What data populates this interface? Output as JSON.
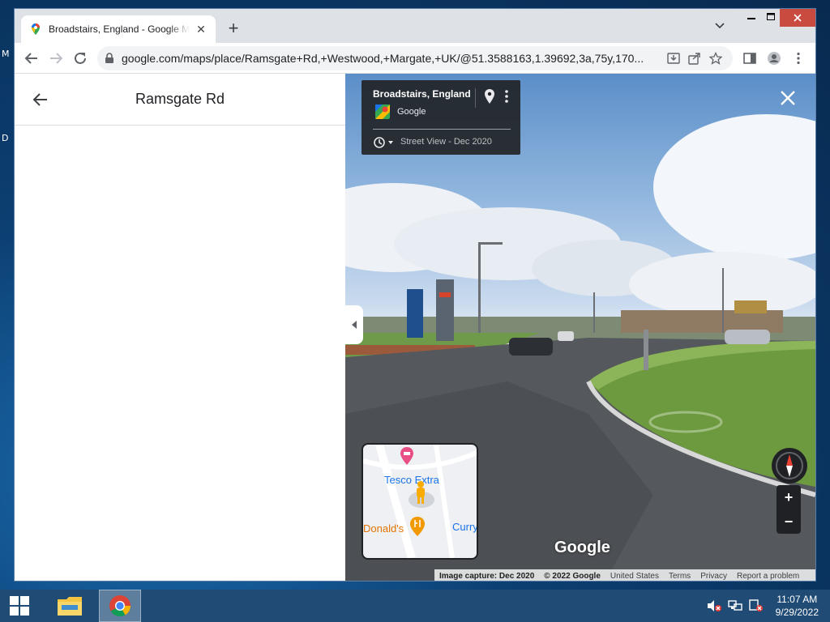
{
  "browser": {
    "tab_title": "Broadstairs, England - Google Maps",
    "tab_close": "✕",
    "new_tab": "+",
    "url": "google.com/maps/place/Ramsgate+Rd,+Westwood,+Margate,+UK/@51.3588163,1.39692,3a,75y,170..."
  },
  "side_panel": {
    "title": "Ramsgate Rd"
  },
  "street_view": {
    "location_title": "Broadstairs, England",
    "provider": "Google",
    "capture_label": "Street View - Dec 2020",
    "logo_text": "Google",
    "attribution": {
      "capture": "Image capture: Dec 2020",
      "copyright": "© 2022 Google",
      "region": "United States",
      "terms": "Terms",
      "privacy": "Privacy",
      "report": "Report a problem"
    },
    "zoom_in": "+",
    "zoom_out": "−"
  },
  "minimap": {
    "labels": {
      "tesco": "Tesco Extra",
      "donalds": "Donald's",
      "curry": "Curry"
    }
  },
  "taskbar": {
    "time": "11:07 AM",
    "date": "9/29/2022"
  },
  "desktop": {
    "edge_letters": [
      "M",
      "D"
    ]
  },
  "colors": {
    "taskbar": "#1f4b74",
    "window_chrome": "#dee1e6",
    "accent_blue": "#1a73e8"
  }
}
